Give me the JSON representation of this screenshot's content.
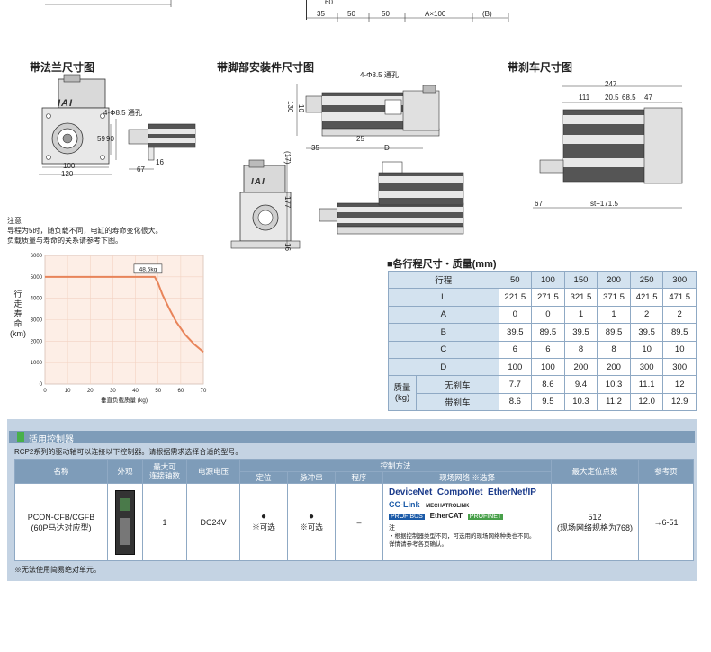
{
  "top_dims": [
    "35",
    "50",
    "50",
    "A×100",
    "(B)",
    "60"
  ],
  "flange": {
    "title": "带法兰尺寸图",
    "hole_label": "4-Φ8.5 通孔",
    "dims": [
      "59",
      "90",
      "100",
      "120",
      "16",
      "67"
    ]
  },
  "foot": {
    "title": "带脚部安装件尺寸图",
    "hole_label": "4-Φ8.5 通孔",
    "dims": [
      "130",
      "10",
      "35",
      "25",
      "D",
      "(17)",
      "177",
      "16"
    ]
  },
  "brake": {
    "title": "带刹车尺寸图",
    "dims": [
      "247",
      "111",
      "20.5",
      "68.5",
      "47",
      "67",
      "st+171.5"
    ]
  },
  "logo_text": "IAI",
  "notes": {
    "heading": "注意",
    "lines": [
      "导程为5时，随负载不同，电缸的寿命变化很大。",
      "负载质量与寿命的关系请参考下图。"
    ]
  },
  "chart_data": {
    "type": "line",
    "ylabel_lines": [
      "行",
      "走",
      "寿",
      "命",
      "(km)"
    ],
    "xlabel": "垂直负载质量 (kg)",
    "x_ticks": [
      "0",
      "10",
      "20",
      "30",
      "40",
      "50",
      "60",
      "70"
    ],
    "y_ticks": [
      "0",
      "1000",
      "2000",
      "3000",
      "4000",
      "5000",
      "6000"
    ],
    "xlim": [
      0,
      70
    ],
    "ylim": [
      0,
      6000
    ],
    "annotation": "48.5kg",
    "color": "#e8845a",
    "series": [
      {
        "x": [
          0,
          48.5,
          50,
          52,
          55,
          58,
          62,
          66,
          70
        ],
        "y": [
          5000,
          5000,
          4700,
          4150,
          3500,
          2900,
          2300,
          1850,
          1500
        ]
      }
    ]
  },
  "spec": {
    "title": "■各行程尺寸・质量(mm)",
    "stroke_label": "行程",
    "strokes": [
      "50",
      "100",
      "150",
      "200",
      "250",
      "300"
    ],
    "rows": [
      {
        "label": "L",
        "values": [
          "221.5",
          "271.5",
          "321.5",
          "371.5",
          "421.5",
          "471.5"
        ]
      },
      {
        "label": "A",
        "values": [
          "0",
          "0",
          "1",
          "1",
          "2",
          "2"
        ]
      },
      {
        "label": "B",
        "values": [
          "39.5",
          "89.5",
          "39.5",
          "89.5",
          "39.5",
          "89.5"
        ]
      },
      {
        "label": "C",
        "values": [
          "6",
          "6",
          "8",
          "8",
          "10",
          "10"
        ]
      },
      {
        "label": "D",
        "values": [
          "100",
          "100",
          "200",
          "200",
          "300",
          "300"
        ]
      }
    ],
    "mass_label": "质量\n(kg)",
    "mass_rows": [
      {
        "label": "无刹车",
        "values": [
          "7.7",
          "8.6",
          "9.4",
          "10.3",
          "11.1",
          "12"
        ]
      },
      {
        "label": "带刹车",
        "values": [
          "8.6",
          "9.5",
          "10.3",
          "11.2",
          "12.0",
          "12.9"
        ]
      }
    ]
  },
  "controller": {
    "title": "适用控制器",
    "desc": "RCP2系列的驱动轴可以连接以下控制器。请根据需求选择合适的型号。",
    "headers": {
      "name": "名称",
      "appearance": "外观",
      "max_axes": "最大可\n连接轴数",
      "power": "电源电压",
      "control": "控制方法",
      "positioning": "定位",
      "pulse": "脉冲串",
      "program": "程序",
      "network": "现场网络 ※选择",
      "max_points": "最大定位点数",
      "ref": "参考页"
    },
    "row": {
      "name": "PCON-CFB/CGFB\n(60P马达对应型)",
      "axes": "1",
      "power": "DC24V",
      "pos_dot": "●",
      "pos_note": "※可选",
      "pulse_dot": "●",
      "pulse_note": "※可选",
      "program": "–",
      "networks": [
        "DeviceNet",
        "CompoNet",
        "EtherNet/IP",
        "CC-Link",
        "MECHATROLINK",
        "PROFIBUS",
        "EtherCAT",
        "PROFINET"
      ],
      "net_note_title": "注",
      "net_note": "・根据控制器类型不同，可选用的现场网络种类也不同。\n  详情请参考各页确认。",
      "max_points": "512\n(现场网络规格为768)",
      "ref": "→6-51"
    },
    "footnote": "※无法使用简易绝对单元。"
  }
}
